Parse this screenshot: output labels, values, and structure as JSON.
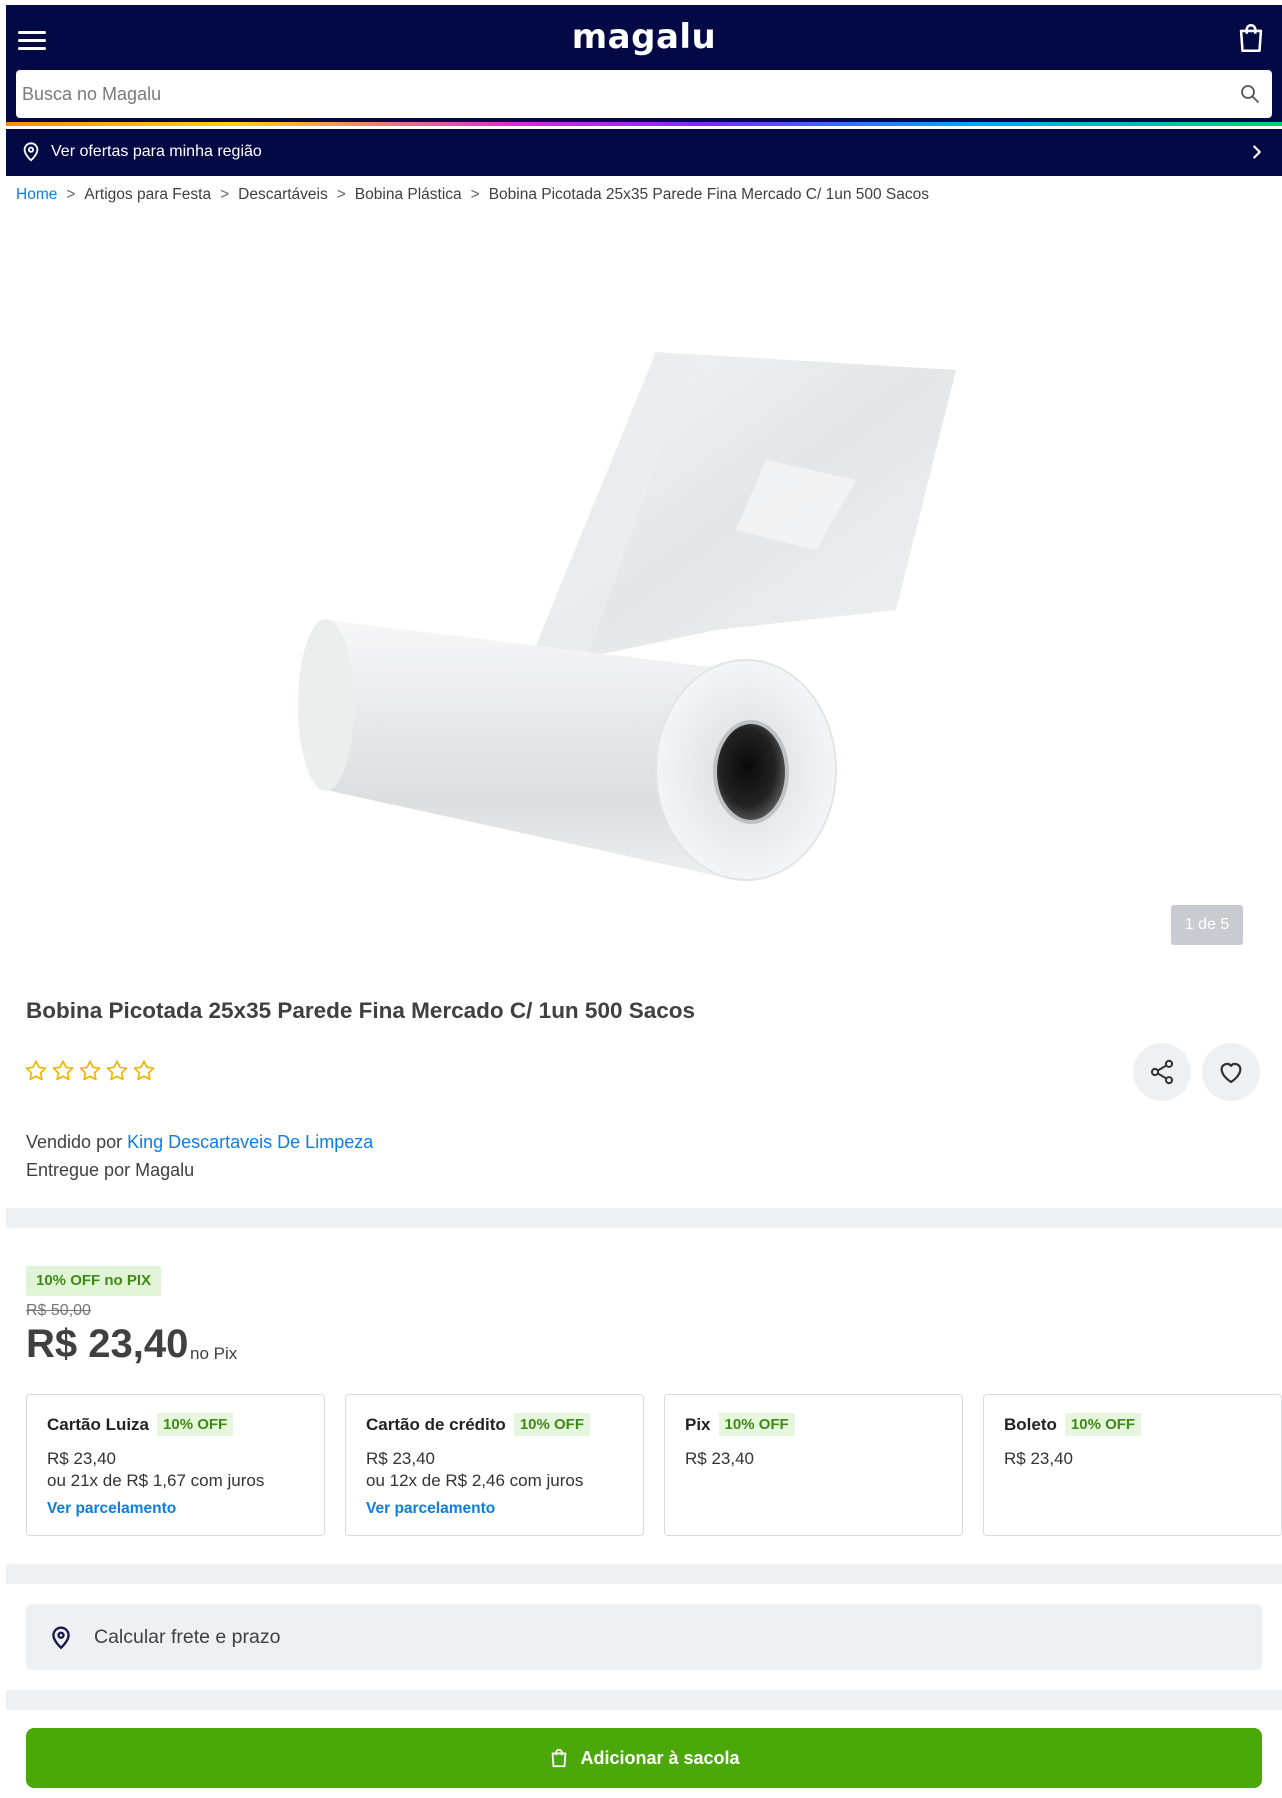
{
  "header": {
    "logo": "magalu",
    "search_placeholder": "Busca no Magalu"
  },
  "region": {
    "label": "Ver ofertas para minha região"
  },
  "breadcrumb": {
    "items": [
      "Home",
      "Artigos para Festa",
      "Descartáveis",
      "Bobina Plástica",
      "Bobina Picotada 25x35 Parede Fina Mercado C/ 1un 500 Sacos"
    ],
    "separator": ">"
  },
  "product": {
    "image_counter": "1 de 5",
    "title": "Bobina Picotada 25x35 Parede Fina Mercado C/ 1un 500 Sacos",
    "rating": 0,
    "rating_max": 5,
    "sold_by_prefix": "Vendido por",
    "seller": "King Descartaveis De Limpeza",
    "delivered_by": "Entregue por Magalu"
  },
  "pricing": {
    "badge": "10% OFF no PIX",
    "old_price": "R$ 50,00",
    "price": "R$ 23,40",
    "price_suffix": "no Pix"
  },
  "payment_options": [
    {
      "name": "Cartão Luiza",
      "discount": "10% OFF",
      "amount": "R$ 23,40",
      "installments": "ou 21x de R$ 1,67 com juros",
      "link": "Ver parcelamento"
    },
    {
      "name": "Cartão de crédito",
      "discount": "10% OFF",
      "amount": "R$ 23,40",
      "installments": "ou 12x de R$ 2,46 com juros",
      "link": "Ver parcelamento"
    },
    {
      "name": "Pix",
      "discount": "10% OFF",
      "amount": "R$ 23,40"
    },
    {
      "name": "Boleto",
      "discount": "10% OFF",
      "amount": "R$ 23,40"
    }
  ],
  "freight": {
    "label": "Calcular frete e prazo"
  },
  "cart": {
    "label": "Adicionar à sacola"
  },
  "colors": {
    "header_bg": "#030944",
    "link_blue": "#0a7ee6",
    "primary_green": "#4aa809",
    "discount_green": "#3e8b13"
  },
  "icons": [
    "menu-icon",
    "shopping-bag-icon",
    "search-icon",
    "location-pin-icon",
    "chevron-right-icon",
    "star-outline-icon",
    "share-icon",
    "heart-icon"
  ]
}
